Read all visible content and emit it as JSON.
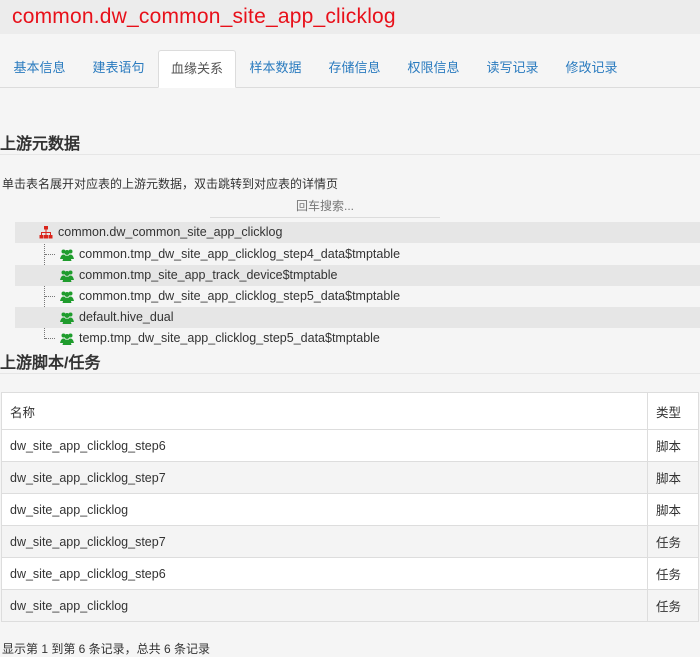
{
  "header": {
    "title": "common.dw_common_site_app_clicklog"
  },
  "tabs": [
    {
      "label": "基本信息",
      "active": false
    },
    {
      "label": "建表语句",
      "active": false
    },
    {
      "label": "血缘关系",
      "active": true
    },
    {
      "label": "样本数据",
      "active": false
    },
    {
      "label": "存储信息",
      "active": false
    },
    {
      "label": "权限信息",
      "active": false
    },
    {
      "label": "读写记录",
      "active": false
    },
    {
      "label": "修改记录",
      "active": false
    }
  ],
  "upstream_meta": {
    "heading": "上游元数据",
    "hint": "单击表名展开对应表的上游元数据，双击跳转到对应表的详情页",
    "search_placeholder": "回车搜索...",
    "tree": {
      "root": {
        "label": "common.dw_common_site_app_clicklog",
        "icon": "sitemap-icon"
      },
      "children": [
        {
          "label": "common.tmp_dw_site_app_clicklog_step4_data$tmptable",
          "icon": "users-icon"
        },
        {
          "label": "common.tmp_site_app_track_device$tmptable",
          "icon": "users-icon"
        },
        {
          "label": "common.tmp_dw_site_app_clicklog_step5_data$tmptable",
          "icon": "users-icon"
        },
        {
          "label": "default.hive_dual",
          "icon": "users-icon"
        },
        {
          "label": "temp.tmp_dw_site_app_clicklog_step5_data$tmptable",
          "icon": "users-icon"
        }
      ]
    }
  },
  "upstream_tasks": {
    "heading": "上游脚本/任务",
    "columns": [
      "名称",
      "类型"
    ],
    "rows": [
      {
        "name": "dw_site_app_clicklog_step6",
        "type": "脚本"
      },
      {
        "name": "dw_site_app_clicklog_step7",
        "type": "脚本"
      },
      {
        "name": "dw_site_app_clicklog",
        "type": "脚本"
      },
      {
        "name": "dw_site_app_clicklog_step7",
        "type": "任务"
      },
      {
        "name": "dw_site_app_clicklog_step6",
        "type": "任务"
      },
      {
        "name": "dw_site_app_clicklog",
        "type": "任务"
      }
    ],
    "pagination_info": "显示第 1 到第 6 条记录，总共 6 条记录"
  },
  "colors": {
    "title_red": "#e8101a",
    "tab_link_blue": "#2a7bbf",
    "root_icon_red": "#d9251c",
    "child_icon_green": "#1f9c2d"
  }
}
